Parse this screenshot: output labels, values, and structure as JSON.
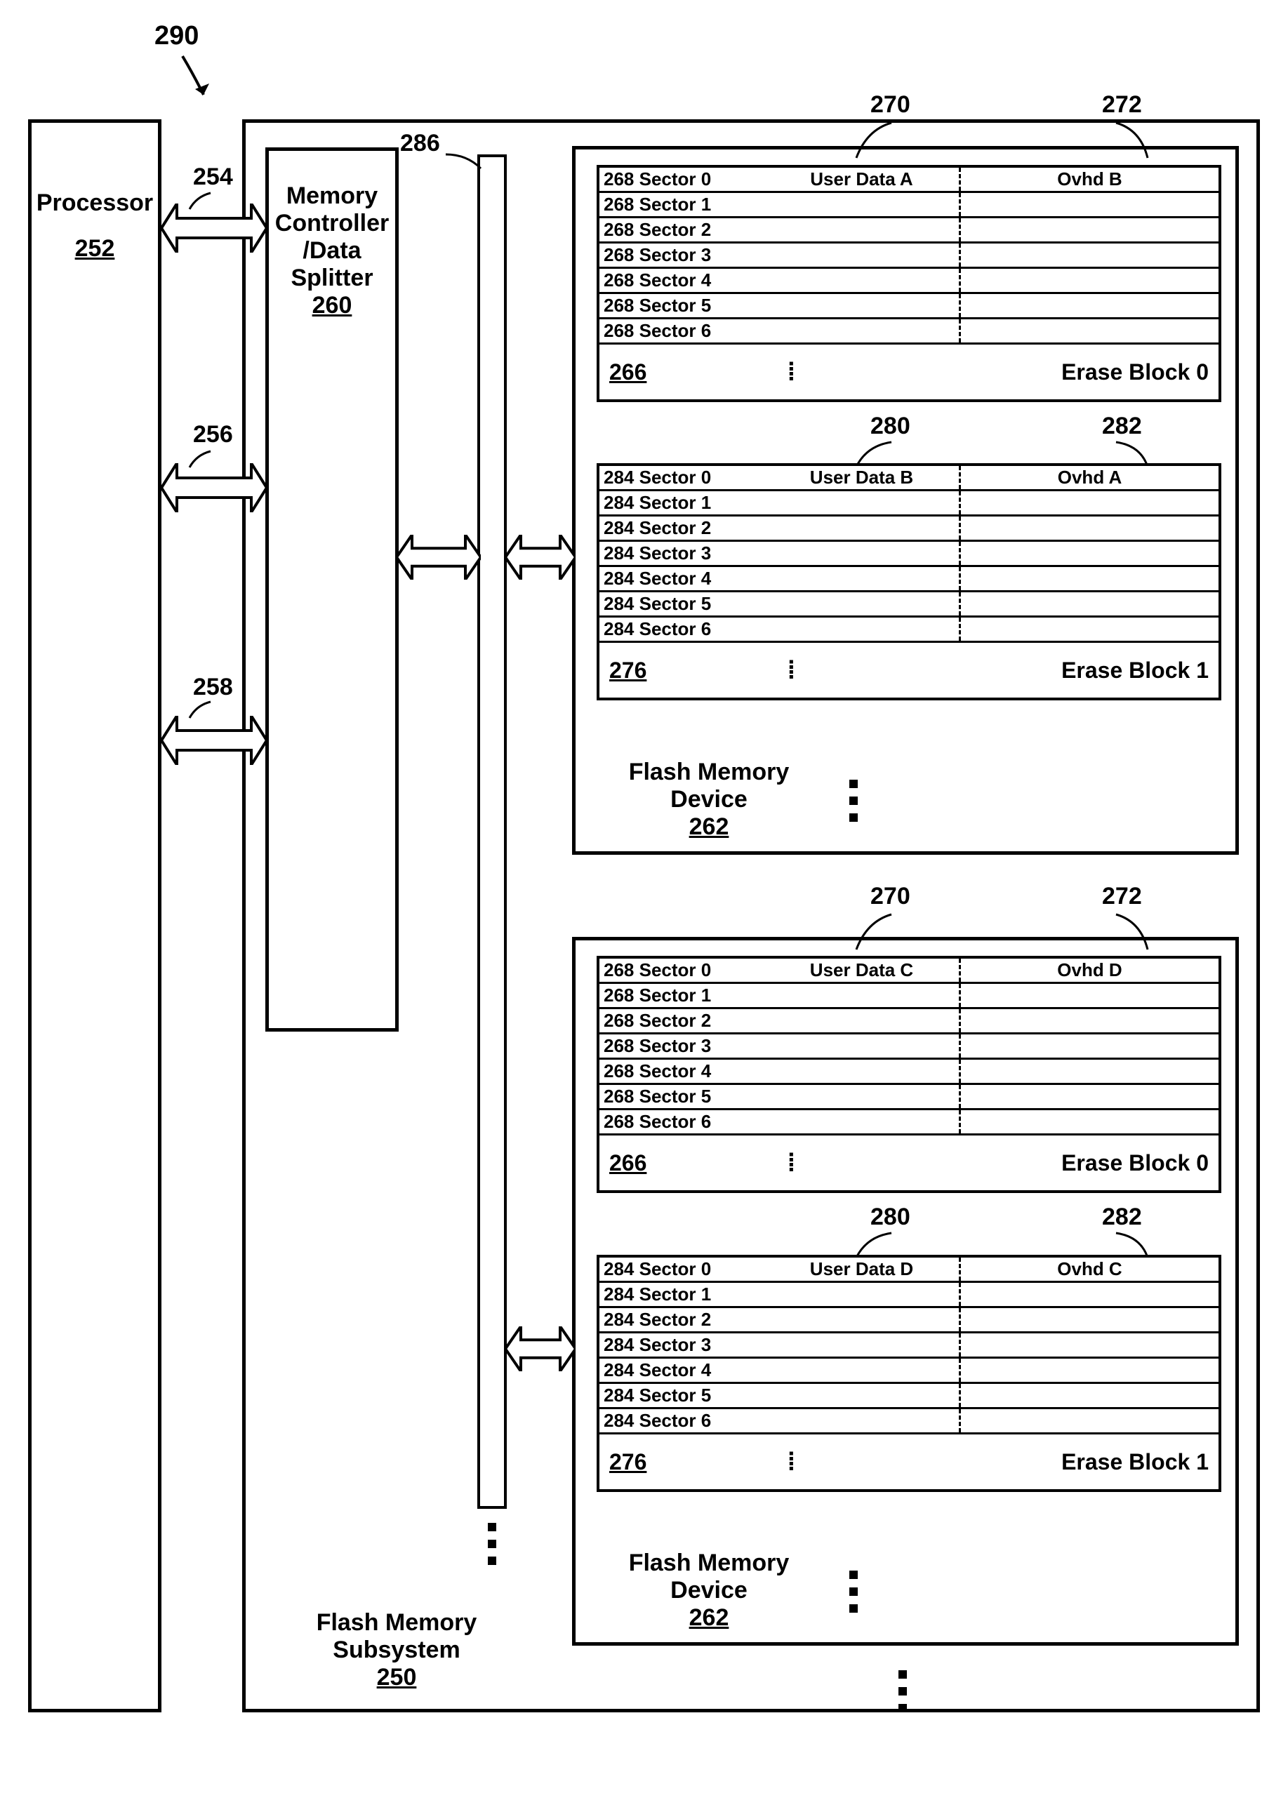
{
  "fig": "290",
  "processor": {
    "title": "Processor",
    "ref": "252"
  },
  "buses": {
    "b1": "254",
    "b2": "256",
    "b3": "258"
  },
  "controller": {
    "line1": "Memory",
    "line2": "Controller",
    "line3": "/Data",
    "line4": "Splitter",
    "ref": "260"
  },
  "bus_ref": "286",
  "subsystem": {
    "line1": "Flash Memory",
    "line2": "Subsystem",
    "ref": "250"
  },
  "device_label": {
    "line1": "Flash Memory",
    "line2": "Device",
    "ref": "262"
  },
  "col_user": "270",
  "col_ovhd": "272",
  "col_user2": "280",
  "col_ovhd2": "282",
  "dev1": {
    "eb0": {
      "ref": "266",
      "title": "Erase Block 0",
      "rows": [
        {
          "id": "268 Sector 0",
          "u": "User Data A",
          "o": "Ovhd B"
        },
        {
          "id": "268 Sector 1",
          "u": "",
          "o": ""
        },
        {
          "id": "268 Sector 2",
          "u": "",
          "o": ""
        },
        {
          "id": "268 Sector 3",
          "u": "",
          "o": ""
        },
        {
          "id": "268 Sector 4",
          "u": "",
          "o": ""
        },
        {
          "id": "268 Sector 5",
          "u": "",
          "o": ""
        },
        {
          "id": "268 Sector 6",
          "u": "",
          "o": ""
        }
      ]
    },
    "eb1": {
      "ref": "276",
      "title": "Erase Block 1",
      "rows": [
        {
          "id": "284 Sector 0",
          "u": "User Data B",
          "o": "Ovhd A"
        },
        {
          "id": "284 Sector 1",
          "u": "",
          "o": ""
        },
        {
          "id": "284 Sector 2",
          "u": "",
          "o": ""
        },
        {
          "id": "284 Sector 3",
          "u": "",
          "o": ""
        },
        {
          "id": "284 Sector 4",
          "u": "",
          "o": ""
        },
        {
          "id": "284 Sector 5",
          "u": "",
          "o": ""
        },
        {
          "id": "284 Sector 6",
          "u": "",
          "o": ""
        }
      ]
    }
  },
  "dev2": {
    "eb0": {
      "ref": "266",
      "title": "Erase Block 0",
      "rows": [
        {
          "id": "268 Sector 0",
          "u": "User Data C",
          "o": "Ovhd D"
        },
        {
          "id": "268 Sector 1",
          "u": "",
          "o": ""
        },
        {
          "id": "268 Sector 2",
          "u": "",
          "o": ""
        },
        {
          "id": "268 Sector 3",
          "u": "",
          "o": ""
        },
        {
          "id": "268 Sector 4",
          "u": "",
          "o": ""
        },
        {
          "id": "268 Sector 5",
          "u": "",
          "o": ""
        },
        {
          "id": "268 Sector 6",
          "u": "",
          "o": ""
        }
      ]
    },
    "eb1": {
      "ref": "276",
      "title": "Erase Block 1",
      "rows": [
        {
          "id": "284 Sector 0",
          "u": "User Data D",
          "o": "Ovhd C"
        },
        {
          "id": "284 Sector 1",
          "u": "",
          "o": ""
        },
        {
          "id": "284 Sector 2",
          "u": "",
          "o": ""
        },
        {
          "id": "284 Sector 3",
          "u": "",
          "o": ""
        },
        {
          "id": "284 Sector 4",
          "u": "",
          "o": ""
        },
        {
          "id": "284 Sector 5",
          "u": "",
          "o": ""
        },
        {
          "id": "284 Sector 6",
          "u": "",
          "o": ""
        }
      ]
    }
  }
}
